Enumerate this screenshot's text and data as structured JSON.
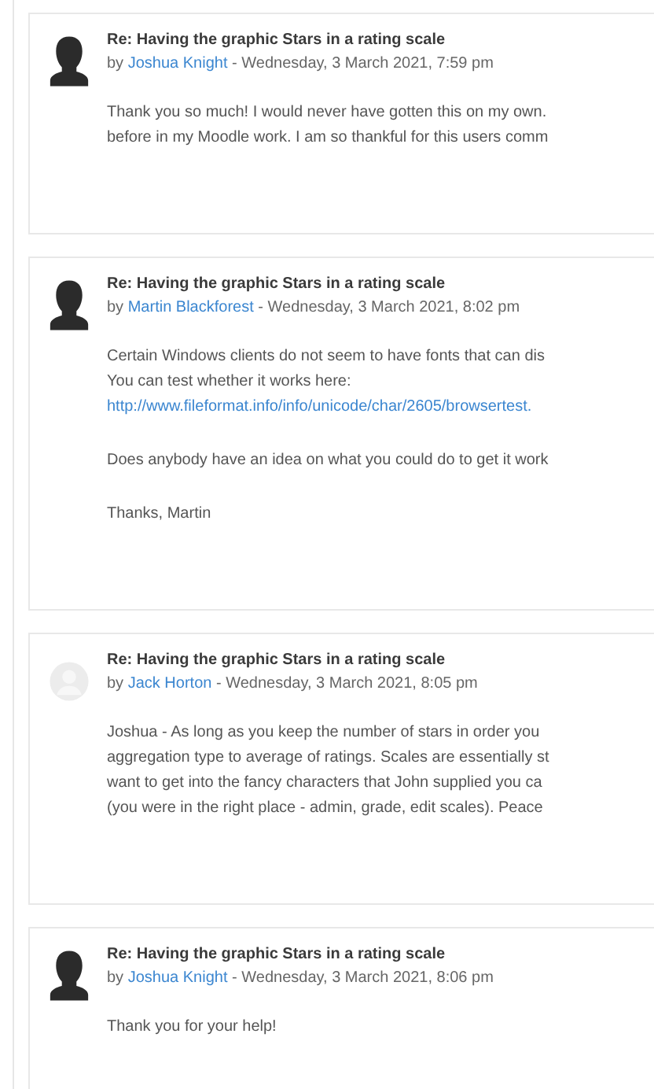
{
  "posts": [
    {
      "kind": "silhouette",
      "subject": "Re: Having the graphic Stars in a rating scale",
      "by": "by",
      "author": "Joshua Knight",
      "date": "- Wednesday, 3 March 2021, 7:59 pm",
      "paragraphs": [
        {
          "kind": "text",
          "lines": [
            "Thank you so much! I would never have gotten this on my own.",
            "before in my Moodle work. I am so thankful for this users comm"
          ]
        }
      ]
    },
    {
      "kind": "silhouette",
      "subject": "Re: Having the graphic Stars in a rating scale",
      "by": "by",
      "author": "Martin Blackforest",
      "date": "- Wednesday, 3 March 2021, 8:02 pm",
      "paragraphs": [
        {
          "kind": "text",
          "lines": [
            "Certain Windows clients do not seem to have fonts that can dis",
            "You can test whether it works here:"
          ]
        },
        {
          "kind": "link",
          "lines": [
            "http://www.fileformat.info/info/unicode/char/2605/browsertest."
          ]
        },
        {
          "kind": "text",
          "lines": [
            "Does anybody have an idea on what you could do to get it work"
          ]
        },
        {
          "kind": "text",
          "lines": [
            "Thanks, Martin"
          ]
        }
      ]
    },
    {
      "kind": "default",
      "subject": "Re: Having the graphic Stars in a rating scale",
      "by": "by",
      "author": "Jack Horton",
      "date": "- Wednesday, 3 March 2021, 8:05 pm",
      "paragraphs": [
        {
          "kind": "text",
          "lines": [
            "Joshua - As long as you keep the number of stars in order you",
            "aggregation type to average of ratings. Scales are essentially st",
            "want to get into the fancy characters that John supplied you ca",
            "(you were in the right place - admin, grade, edit scales). Peace"
          ]
        }
      ]
    },
    {
      "kind": "silhouette",
      "subject": "Re: Having the graphic Stars in a rating scale",
      "by": "by",
      "author": "Joshua Knight",
      "date": "- Wednesday, 3 March 2021, 8:06 pm",
      "paragraphs": [
        {
          "kind": "text",
          "lines": [
            "Thank you for your help!"
          ]
        }
      ]
    }
  ]
}
